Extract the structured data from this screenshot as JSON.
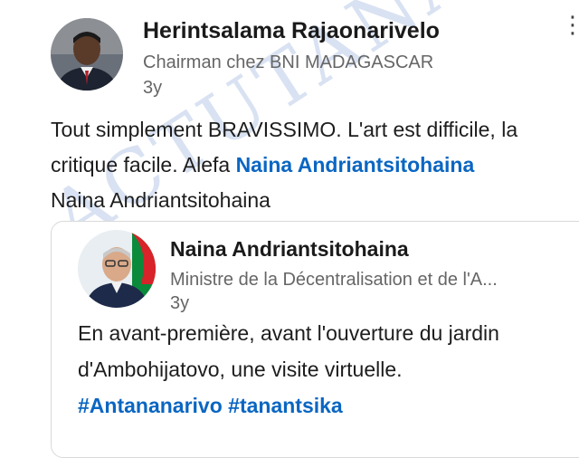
{
  "post": {
    "author": "Herintsalama Rajaonarivelo",
    "headline": "Chairman chez BNI MADAGASCAR",
    "time": "3y",
    "menu_icon": "more-vertical-icon",
    "body_text_1": "Tout simplement BRAVISSIMO. L'art est difficile, la critique facile. Alefa ",
    "mention_1": "Naina Andriantsitohaina",
    "mention_2": "Naina Andriantsitohaina"
  },
  "shared": {
    "author": "Naina Andriantsitohaina",
    "headline": "Ministre de la Décentralisation et de l'A...",
    "time": "3y",
    "body_text": "En avant-première, avant l'ouverture du jardin d'Ambohijatovo, une visite virtuelle.",
    "hashtag_1": "#Antananarivo",
    "hashtag_2": "#tanantsika"
  },
  "watermark": "ACTUTANA.COM",
  "colors": {
    "link": "#0a66c2",
    "secondary_text": "#666666",
    "watermark": "#7896d2"
  }
}
